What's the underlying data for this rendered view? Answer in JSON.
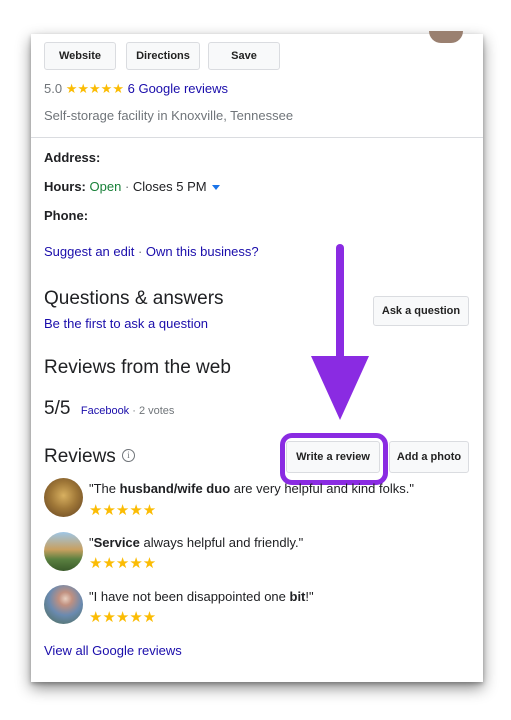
{
  "actions": {
    "website": "Website",
    "directions": "Directions",
    "save": "Save"
  },
  "rating": {
    "score": "5.0",
    "stars": "★★★★★",
    "reviews_link": "6 Google reviews"
  },
  "category": "Self-storage facility in Knoxville, Tennessee",
  "details": {
    "address_label": "Address:",
    "hours_label": "Hours:",
    "hours_status": "Open",
    "hours_sep": " · ",
    "hours_close": "Closes 5 PM",
    "phone_label": "Phone:"
  },
  "edit": {
    "suggest": "Suggest an edit",
    "sep": " · ",
    "own": "Own this business?"
  },
  "qa": {
    "title": "Questions & answers",
    "link": "Be the first to ask a question",
    "button": "Ask a question"
  },
  "web_reviews": {
    "title": "Reviews from the web",
    "score": "5/5",
    "source": "Facebook",
    "votes": " · 2 votes"
  },
  "reviews": {
    "title": "Reviews",
    "info_icon": "info-icon",
    "write_button": "Write a review",
    "photo_button": "Add a photo",
    "items": [
      {
        "pre": "\"The ",
        "bold": "husband/wife duo",
        "post": " are very helpful and kind folks.\"",
        "stars": "★★★★★"
      },
      {
        "pre": "\"",
        "bold": "Service",
        "post": " always helpful and friendly.\"",
        "stars": "★★★★★"
      },
      {
        "pre": "\"I have not been disappointed one ",
        "bold": "bit",
        "post": "!\"",
        "stars": "★★★★★"
      }
    ],
    "view_all": "View all Google reviews"
  },
  "annotation": {
    "arrow_color": "#8a2be2",
    "highlight_color": "#8a2be2"
  }
}
